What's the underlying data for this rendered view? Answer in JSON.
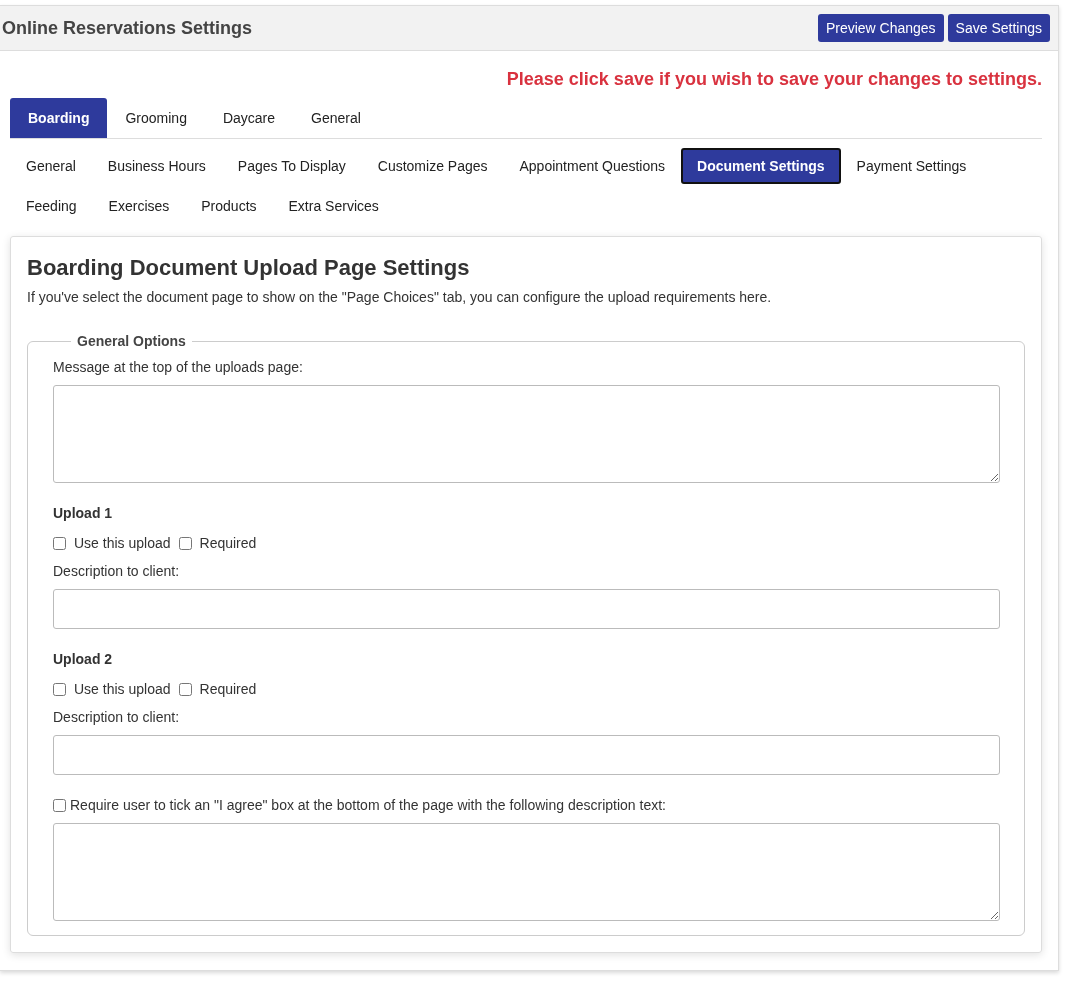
{
  "header": {
    "title": "Online Reservations Settings",
    "buttons": [
      "Preview Changes",
      "Save Settings"
    ]
  },
  "notice": "Please click save if you wish to save your changes to settings.",
  "main_tabs": [
    {
      "label": "Boarding",
      "selected": true
    },
    {
      "label": "Grooming",
      "selected": false
    },
    {
      "label": "Daycare",
      "selected": false
    },
    {
      "label": "General",
      "selected": false
    }
  ],
  "sub_tabs": [
    {
      "label": "General",
      "selected": false
    },
    {
      "label": "Business Hours",
      "selected": false
    },
    {
      "label": "Pages To Display",
      "selected": false
    },
    {
      "label": "Customize Pages",
      "selected": false
    },
    {
      "label": "Appointment Questions",
      "selected": false
    },
    {
      "label": "Document Settings",
      "selected": true
    },
    {
      "label": "Payment Settings",
      "selected": false
    },
    {
      "label": "Feeding",
      "selected": false
    },
    {
      "label": "Exercises",
      "selected": false
    },
    {
      "label": "Products",
      "selected": false
    },
    {
      "label": "Extra Services",
      "selected": false
    }
  ],
  "panel": {
    "title": "Boarding Document Upload Page Settings",
    "description": "If you've select the document page to show on the \"Page Choices\" tab, you can configure the upload requirements here.",
    "fieldset": {
      "legend": "General Options",
      "message_label": "Message at the top of the uploads page:",
      "uploads": [
        {
          "heading": "Upload 1",
          "use_label": "Use this upload",
          "use_checked": false,
          "required_label": "Required",
          "required_checked": false,
          "description_label": "Description to client:"
        },
        {
          "heading": "Upload 2",
          "use_label": "Use this upload",
          "use_checked": false,
          "required_label": "Required",
          "required_checked": false,
          "description_label": "Description to client:"
        }
      ],
      "agree": {
        "label": "Require user to tick an \"I agree\" box at the bottom of the page with the following description text:",
        "checked": false
      }
    }
  }
}
